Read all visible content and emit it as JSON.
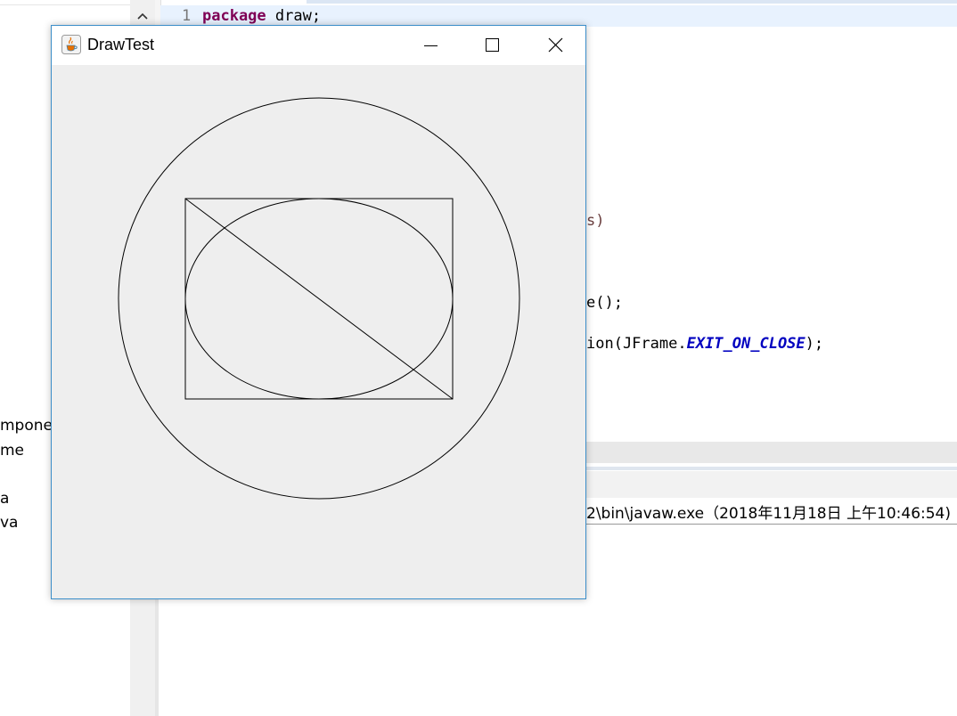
{
  "explorer": {
    "items": [
      "mpone",
      "me",
      "a",
      "va"
    ]
  },
  "editor": {
    "line_number": "1",
    "line1_keyword": "package",
    "line1_rest": " draw;",
    "frag_args": "s)",
    "frag_visible": "e();",
    "frag_close_pre": "ion(JFrame.",
    "frag_close_const": "EXIT_ON_CLOSE",
    "frag_close_post": ");"
  },
  "console": {
    "header": "2\\bin\\javaw.exe（2018年11月18日 上午10:46:54)"
  },
  "window": {
    "title": "DrawTest",
    "icon": "java-cup-icon",
    "controls": [
      "minimize-icon",
      "maximize-icon",
      "close-icon"
    ]
  },
  "drawing": {
    "description_shapes": [
      "circle",
      "rectangle",
      "ellipse",
      "diagonal-line"
    ],
    "stroke_color": "#000000",
    "background_color": "#eeeeee"
  }
}
